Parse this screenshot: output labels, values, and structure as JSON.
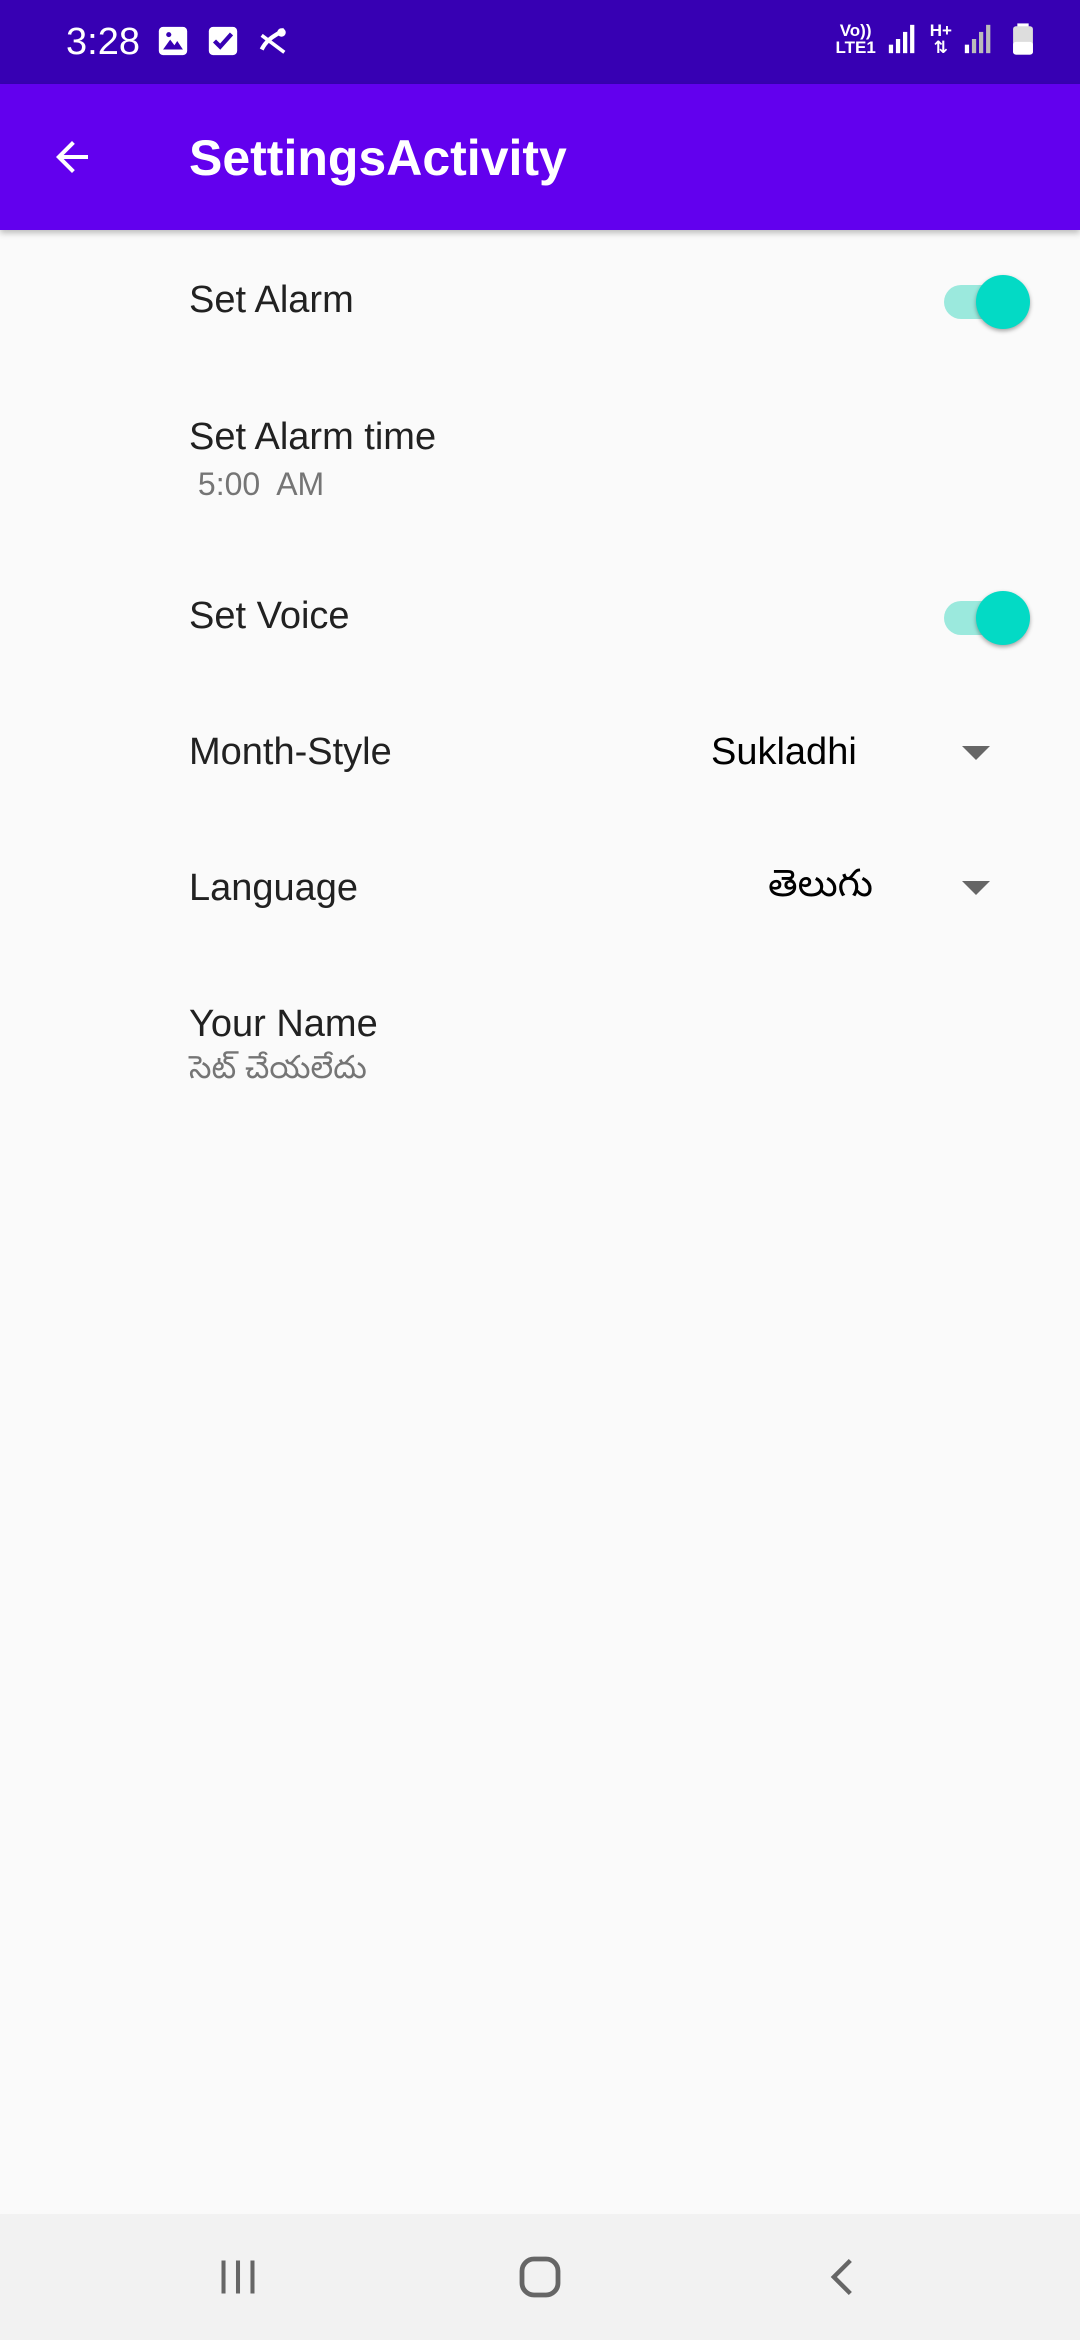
{
  "status_bar": {
    "time": "3:28",
    "icons_left": [
      "gallery-icon",
      "checkbox-icon",
      "missed-call-icon"
    ],
    "network_label_1_top": "Vo))",
    "network_label_1_bottom": "LTE1",
    "network_label_2": "H+",
    "icons_right": [
      "signal-icon",
      "signal-icon",
      "battery-icon"
    ]
  },
  "app_bar": {
    "title": "SettingsActivity",
    "back_icon": "arrow-back-icon"
  },
  "preferences": {
    "set_alarm": {
      "title": "Set Alarm",
      "enabled": true
    },
    "alarm_time": {
      "title": "Set Alarm time",
      "summary": " 5:00  AM"
    },
    "set_voice": {
      "title": "Set Voice",
      "enabled": true
    },
    "month_style": {
      "title": "Month-Style",
      "value": "Sukladhi"
    },
    "language": {
      "title": "Language",
      "value": "తెలుగు"
    },
    "your_name": {
      "title": "Your Name",
      "summary": "సెట్ చేయలేదు"
    }
  },
  "colors": {
    "status_bar": "#3700b3",
    "app_bar": "#6200ee",
    "switch_thumb": "#03dac5",
    "switch_track": "#9be9dd"
  },
  "nav_bar": {
    "icons": [
      "recent-apps-icon",
      "home-icon",
      "back-icon"
    ]
  }
}
